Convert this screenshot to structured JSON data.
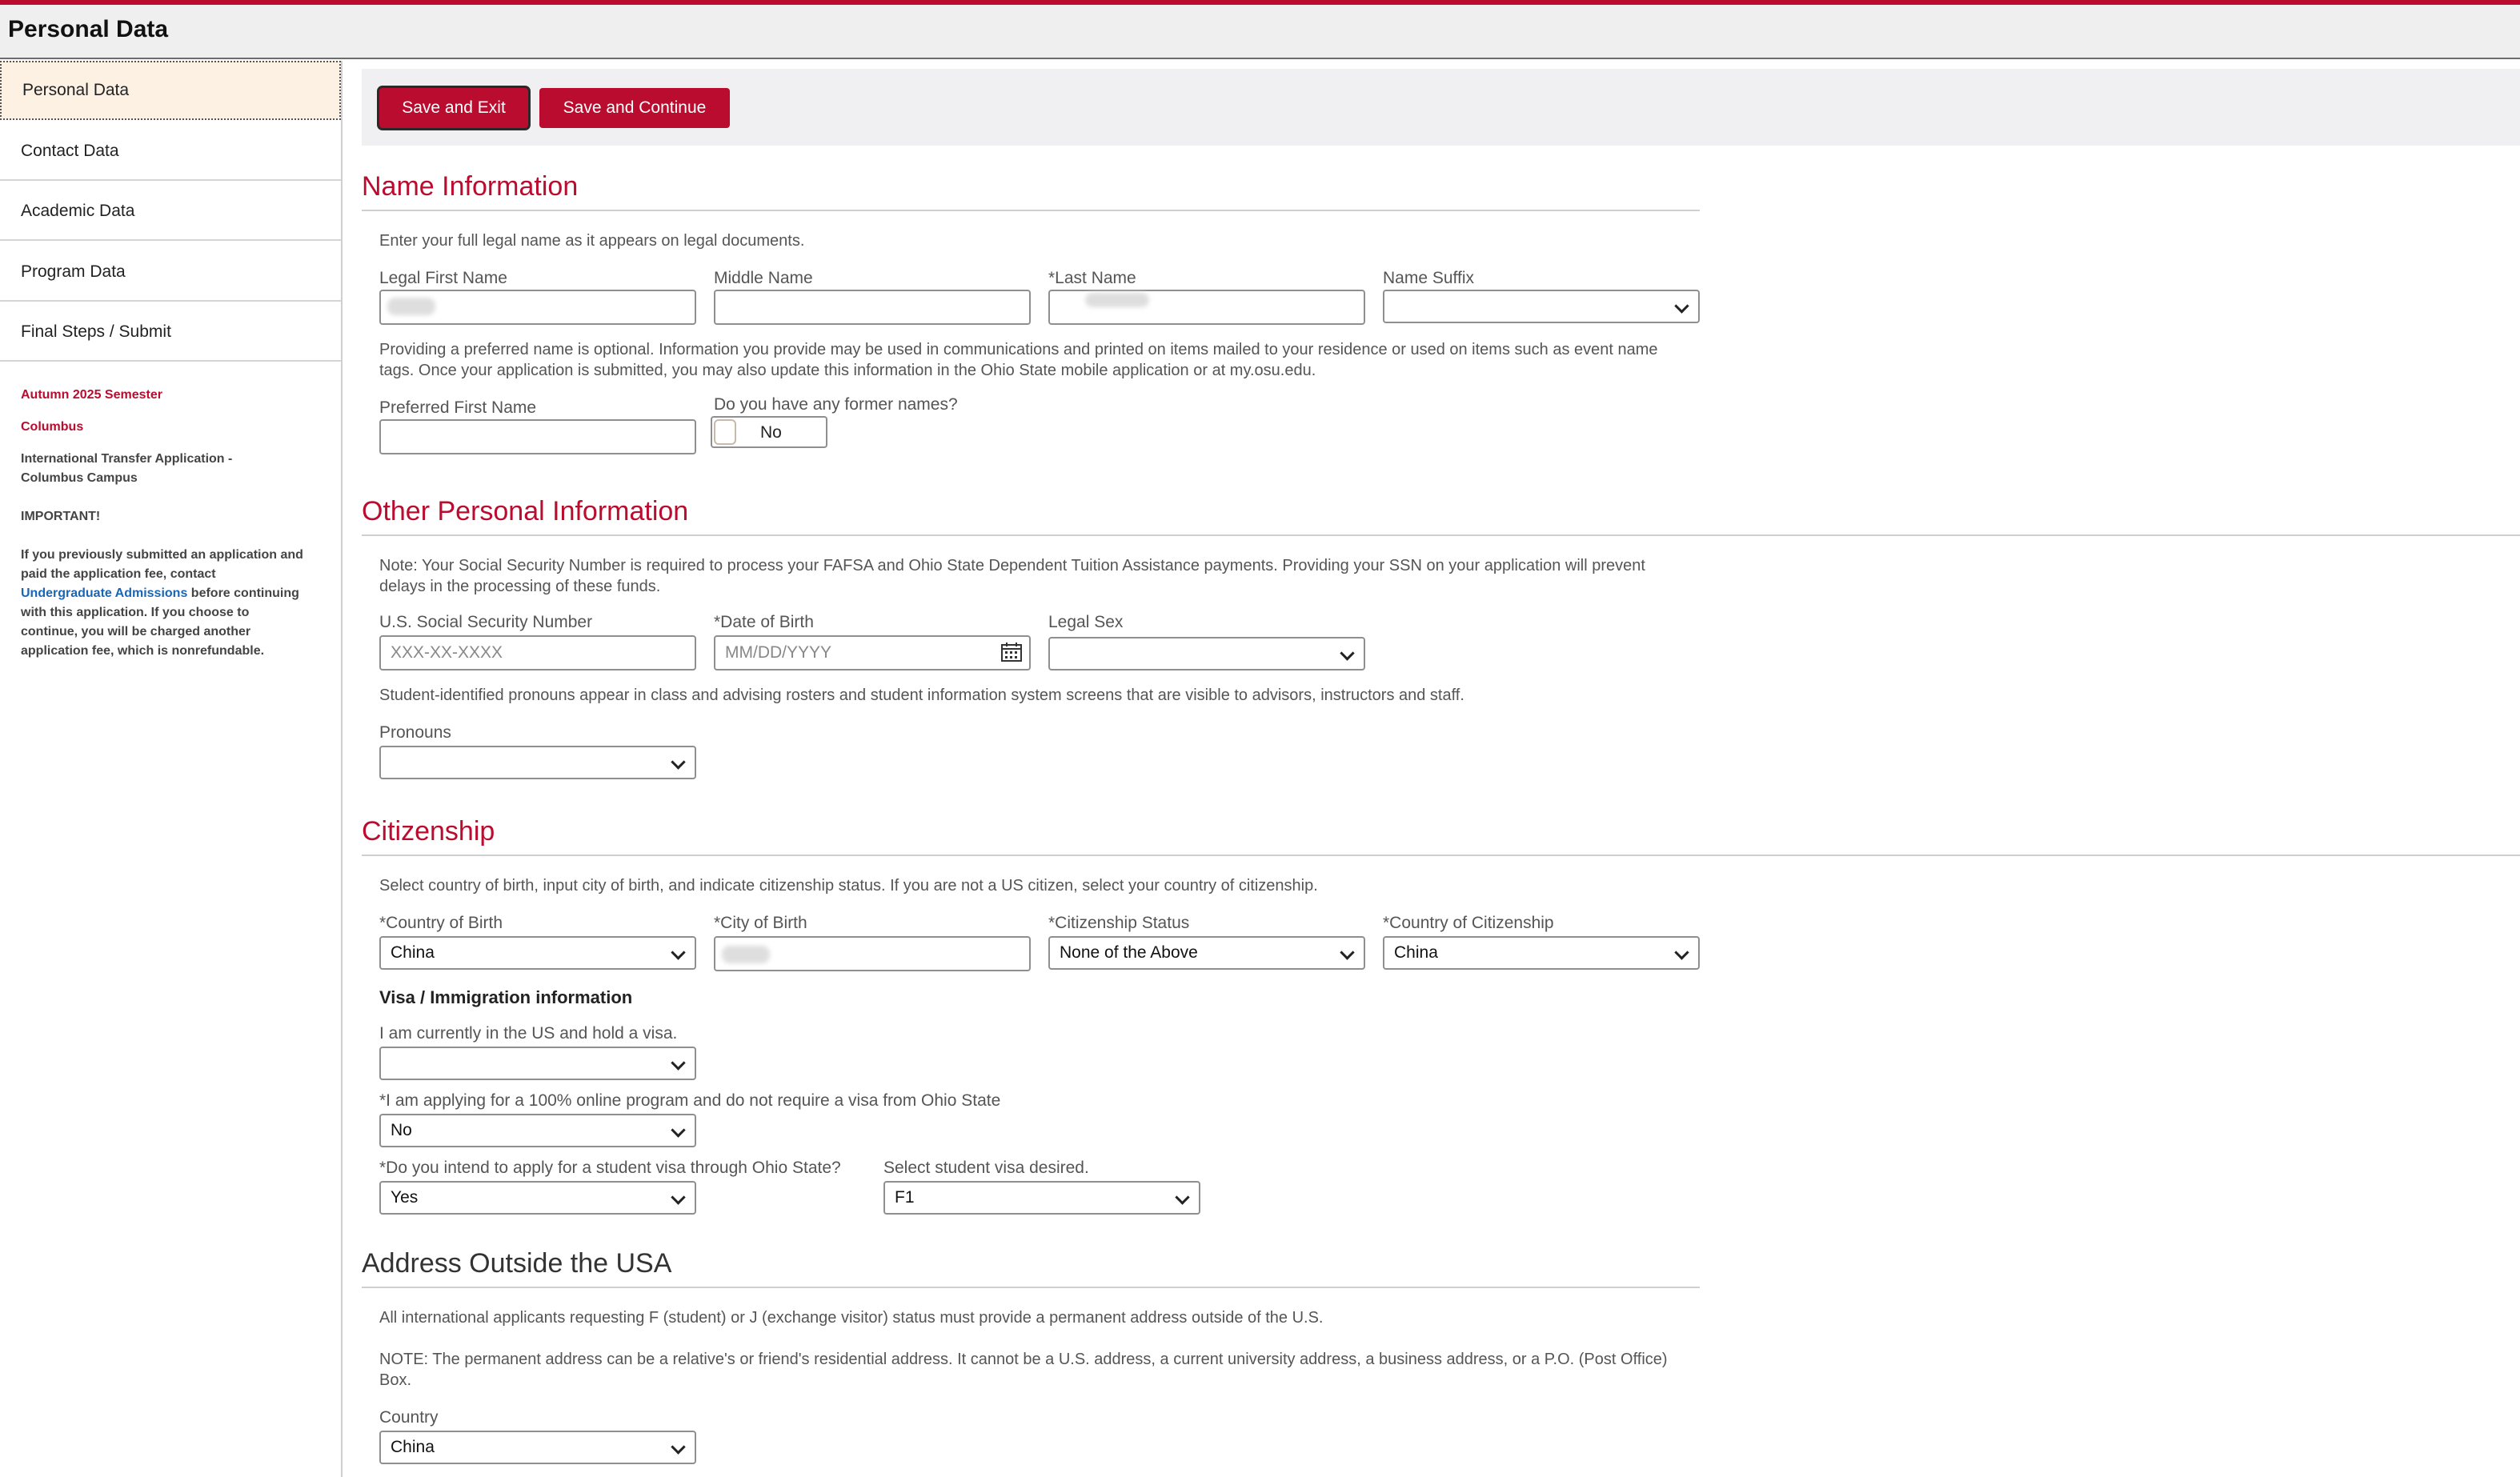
{
  "page": {
    "title": "Personal Data"
  },
  "sidebar": {
    "items": [
      {
        "label": "Personal Data"
      },
      {
        "label": "Contact Data"
      },
      {
        "label": "Academic Data"
      },
      {
        "label": "Program Data"
      },
      {
        "label": "Final Steps / Submit"
      }
    ],
    "term": "Autumn 2025 Semester",
    "campus": "Columbus",
    "application_type": "International Transfer Application - Columbus Campus",
    "important_label": "IMPORTANT!",
    "important_text_before": "If you previously submitted an application and paid the application fee, contact",
    "important_link": "Undergraduate Admissions",
    "important_text_after": "before continuing with this application. If you choose to continue, you will be charged another application fee, which is nonrefundable."
  },
  "actions": {
    "save_exit": "Save and Exit",
    "save_continue": "Save and Continue"
  },
  "name_info": {
    "title": "Name Information",
    "intro": "Enter your full legal name as it appears on legal documents.",
    "first_name_label": "Legal First Name",
    "middle_name_label": "Middle Name",
    "last_name_label": "*Last Name",
    "suffix_label": "Name Suffix",
    "suffix_value": "",
    "preferred_note": "Providing a preferred name is optional. Information you provide may be used in communications and printed on items mailed to your residence or used on items such as event name tags. Once your application is submitted, you may also update this information in the Ohio State mobile application or at my.osu.edu.",
    "preferred_label": "Preferred First Name",
    "former_names_label": "Do you have any former names?",
    "former_names_value": "No"
  },
  "other_info": {
    "title": "Other Personal Information",
    "note": "Note: Your Social Security Number is required to process your FAFSA and Ohio State Dependent Tuition Assistance payments. Providing your SSN on your application will prevent delays in the processing of these funds.",
    "ssn_label": "U.S. Social Security Number",
    "ssn_placeholder": "XXX-XX-XXXX",
    "dob_label": "*Date of Birth",
    "dob_placeholder": "MM/DD/YYYY",
    "sex_label": "Legal Sex",
    "sex_value": "",
    "pronouns_note": "Student-identified pronouns appear in class and advising rosters and student information system screens that are visible to advisors, instructors and staff.",
    "pronouns_label": "Pronouns",
    "pronouns_value": ""
  },
  "citizenship": {
    "title": "Citizenship",
    "intro": "Select country of birth, input city of birth, and indicate citizenship status. If you are not a US citizen, select your country of citizenship.",
    "birth_country_label": "*Country of Birth",
    "birth_country_value": "China",
    "birth_city_label": "*City of Birth",
    "status_label": "*Citizenship Status",
    "status_value": "None of the Above",
    "citizenship_country_label": "*Country of Citizenship",
    "citizenship_country_value": "China",
    "visa_heading": "Visa / Immigration information",
    "current_visa_label": "I am currently in the US and hold a visa.",
    "current_visa_value": "",
    "online_label": "*I am applying for a 100% online program and do not require a visa from Ohio State",
    "online_value": "No",
    "student_visa_label": "*Do you intend to apply for a student visa through Ohio State?",
    "student_visa_value": "Yes",
    "visa_type_label": "Select student visa desired.",
    "visa_type_value": "F1"
  },
  "address": {
    "title": "Address Outside the USA",
    "intro": "All international applicants requesting F (student) or J (exchange visitor) status must provide a permanent address outside of the U.S.",
    "note": "NOTE: The permanent address can be a relative's or friend's residential address. It cannot be a U.S. address, a current university address, a business address, or a P.O. (Post Office) Box.",
    "country_label": "Country",
    "country_value": "China"
  }
}
